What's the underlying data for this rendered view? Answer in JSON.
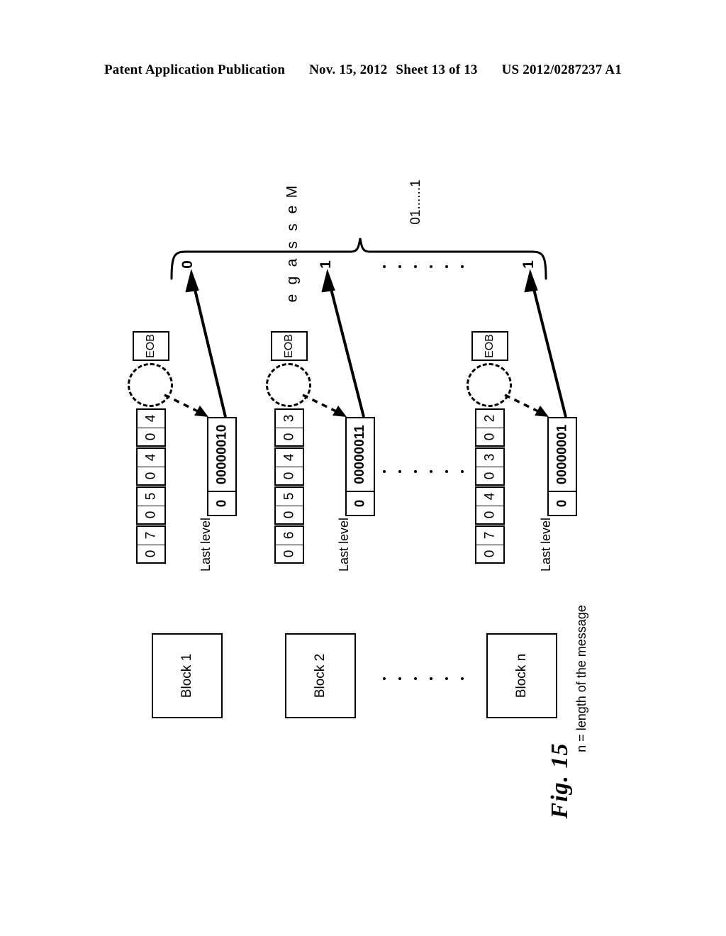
{
  "header": {
    "publication": "Patent Application Publication",
    "date": "Nov. 15, 2012",
    "sheet": "Sheet 13 of 13",
    "number": "US 2012/0287237 A1"
  },
  "figure": {
    "caption": "Fig. 15",
    "note": "n = length of the message",
    "message_label": "Message",
    "message_bits": "01......1",
    "ellipsis_dots": 6,
    "brace_digits": [
      "0",
      "1",
      "1"
    ],
    "eob_label": "EOB",
    "last_level_label": "Last level",
    "columns": [
      {
        "block_label": "Block 1",
        "eob": "EOB",
        "levels": [
          {
            "run": "0",
            "value": "4"
          },
          {
            "run": "0",
            "value": "4"
          },
          {
            "run": "0",
            "value": "5"
          },
          {
            "run": "0",
            "value": "7"
          }
        ],
        "last_level": {
          "flag": "0",
          "code": "00000010"
        },
        "brace_digit": "0"
      },
      {
        "block_label": "Block 2",
        "eob": "EOB",
        "levels": [
          {
            "run": "0",
            "value": "3"
          },
          {
            "run": "0",
            "value": "4"
          },
          {
            "run": "0",
            "value": "5"
          },
          {
            "run": "0",
            "value": "6"
          }
        ],
        "last_level": {
          "flag": "0",
          "code": "00000011"
        },
        "brace_digit": "1"
      },
      {
        "block_label": "Block n",
        "eob": "EOB",
        "levels": [
          {
            "run": "0",
            "value": "2"
          },
          {
            "run": "0",
            "value": "3"
          },
          {
            "run": "0",
            "value": "4"
          },
          {
            "run": "0",
            "value": "7"
          }
        ],
        "last_level": {
          "flag": "0",
          "code": "00000001"
        },
        "brace_digit": "1"
      }
    ]
  }
}
